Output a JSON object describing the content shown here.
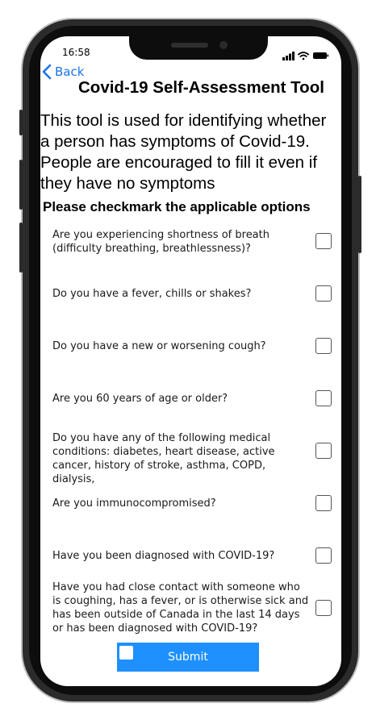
{
  "status_bar": {
    "time": "16:58"
  },
  "nav": {
    "back_label": "Back"
  },
  "page": {
    "title": "Covid-19 Self-Assessment Tool",
    "intro": "This tool is used for identifying whether a person has symptoms of Covid-19. People are encouraged to fill it even if they have no symptoms",
    "instruction": "Please checkmark the applicable options"
  },
  "questions": [
    {
      "text": "Are you experiencing shortness of breath (difficulty breathing, breathlessness)?",
      "checked": false
    },
    {
      "text": "Do you have a fever, chills or shakes?",
      "checked": false
    },
    {
      "text": "Do you have a new or worsening cough?",
      "checked": false
    },
    {
      "text": "Are you 60 years of age or older?",
      "checked": false
    },
    {
      "text": "Do you have any of the following medical conditions: diabetes, heart disease, active cancer, history of stroke, asthma, COPD, dialysis,",
      "checked": false
    },
    {
      "text": "Are you immunocompromised?",
      "checked": false
    },
    {
      "text": "Have you been diagnosed with COVID-19?",
      "checked": false
    },
    {
      "text": "Have you had close contact with someone who is coughing, has a fever, or is otherwise sick and has been outside of Canada in the last 14 days or has been diagnosed with COVID-19?",
      "checked": false
    }
  ],
  "submit": {
    "label": "Submit"
  },
  "colors": {
    "accent": "#1e90ff",
    "link": "#1a73e8",
    "frame": "#2b2b2b"
  },
  "icons": {
    "back": "chevron-left-icon",
    "signal": "signal-icon",
    "wifi": "wifi-icon",
    "battery": "battery-icon"
  }
}
